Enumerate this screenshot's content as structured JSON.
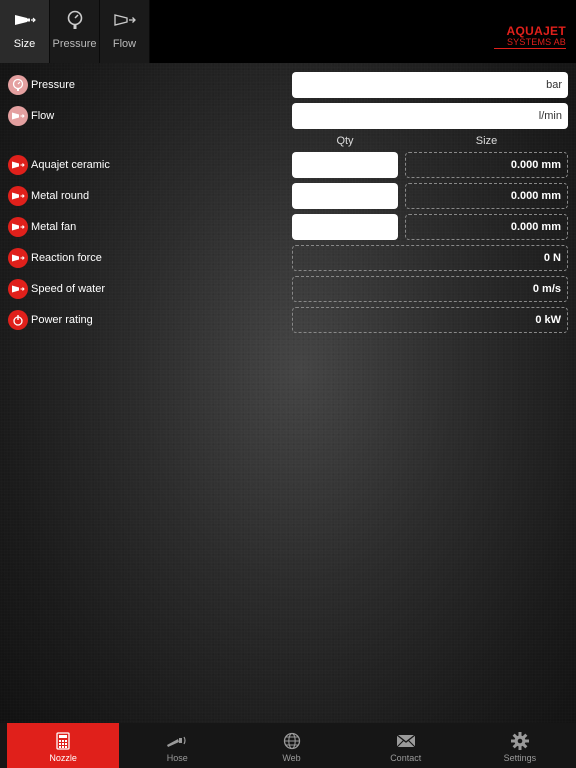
{
  "top_tabs": [
    {
      "label": "Size",
      "icon": "nozzle-icon",
      "active": true
    },
    {
      "label": "Pressure",
      "icon": "pressure-gauge-icon",
      "active": false
    },
    {
      "label": "Flow",
      "icon": "flow-icon",
      "active": false
    }
  ],
  "logo": {
    "line1": "AQUAJET",
    "line2": "SYSTEMS AB"
  },
  "inputs": {
    "pressure": {
      "label": "Pressure",
      "unit": "bar"
    },
    "flow": {
      "label": "Flow",
      "unit": "l/min"
    }
  },
  "columns": {
    "qty": "Qty",
    "size": "Size"
  },
  "nozzles": [
    {
      "label": "Aquajet ceramic",
      "value": "0.000 mm"
    },
    {
      "label": "Metal round",
      "value": "0.000 mm"
    },
    {
      "label": "Metal fan",
      "value": "0.000 mm"
    }
  ],
  "results": [
    {
      "label": "Reaction force",
      "value": "0 N"
    },
    {
      "label": "Speed of water",
      "value": "0 m/s"
    },
    {
      "label": "Power rating",
      "value": "0 kW"
    }
  ],
  "bottom_tabs": [
    {
      "label": "Nozzle",
      "icon": "calculator-icon",
      "active": true
    },
    {
      "label": "Hose",
      "icon": "hose-icon",
      "active": false
    },
    {
      "label": "Web",
      "icon": "globe-icon",
      "active": false
    },
    {
      "label": "Contact",
      "icon": "envelope-icon",
      "active": false
    },
    {
      "label": "Settings",
      "icon": "gear-icon",
      "active": false
    }
  ],
  "colors": {
    "accent": "#e0201b",
    "background": "#2a2a2a",
    "topbar": "#000000"
  }
}
